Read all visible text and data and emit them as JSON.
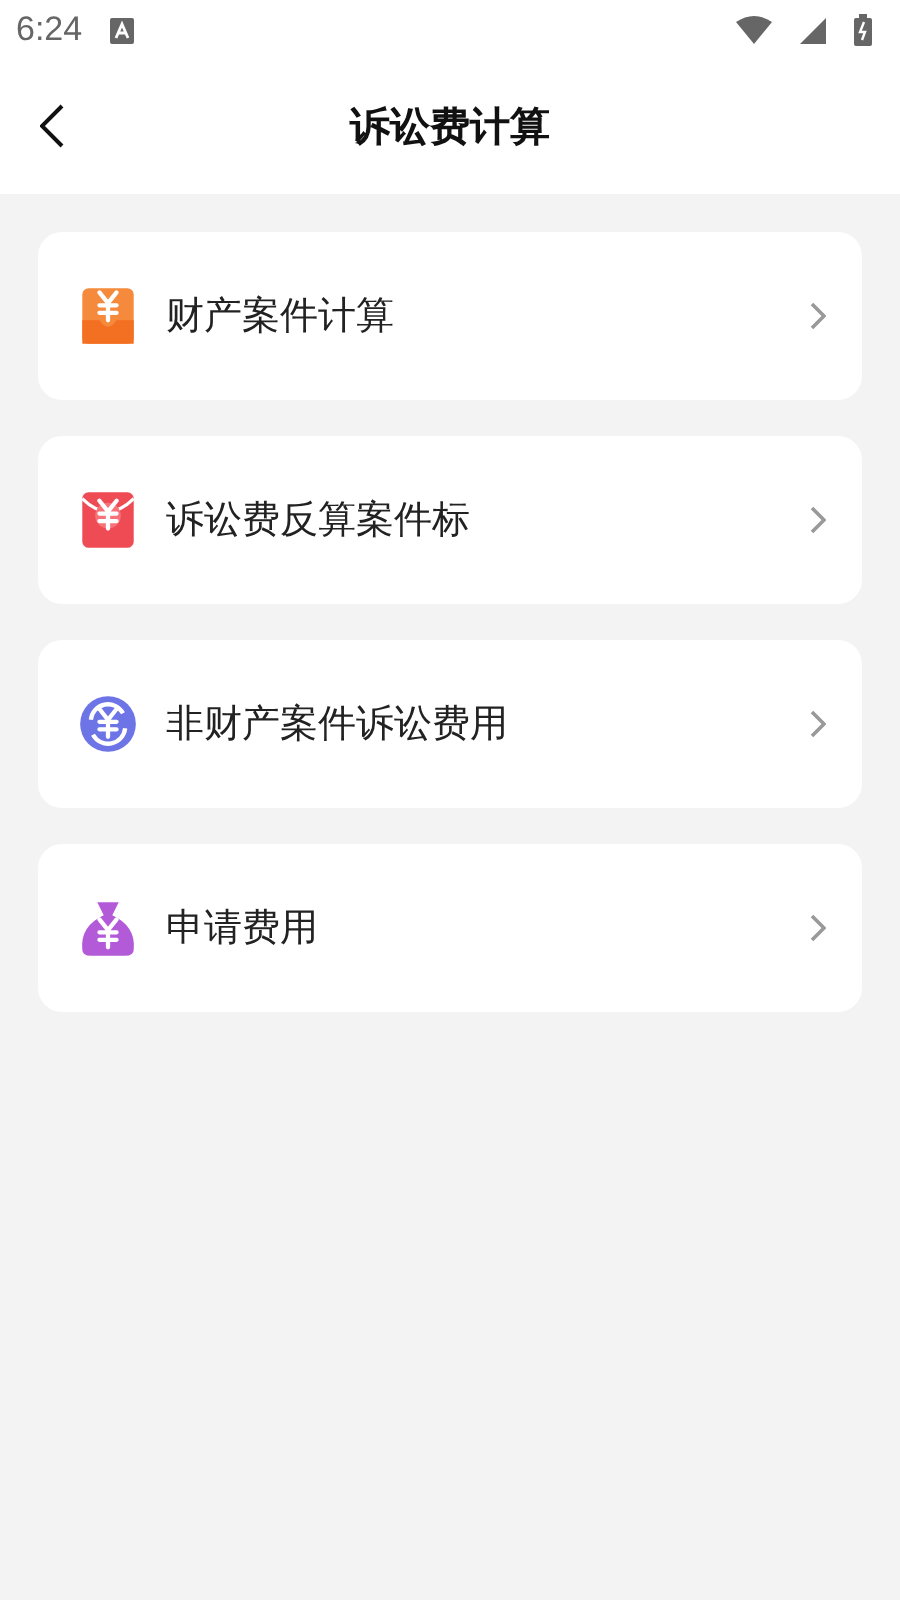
{
  "status_bar": {
    "time": "6:24"
  },
  "header": {
    "title": "诉讼费计算"
  },
  "menu": [
    {
      "label": "财产案件计算",
      "kind": "tray"
    },
    {
      "label": "诉讼费反算案件标",
      "kind": "envelope"
    },
    {
      "label": "非财产案件诉讼费用",
      "kind": "exchange"
    },
    {
      "label": "申请费用",
      "kind": "moneybag"
    }
  ]
}
